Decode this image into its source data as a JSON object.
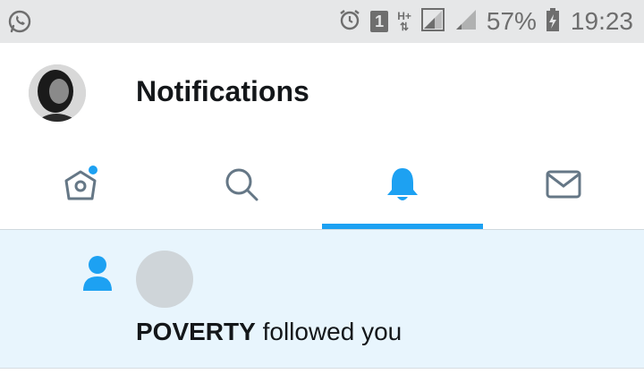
{
  "status_bar": {
    "left_icon": "whatsapp-icon",
    "icons": [
      "alarm-icon",
      "sim-1-badge",
      "hplus-network-icon",
      "signal-icon",
      "signal-weak-icon",
      "battery-charging-icon"
    ],
    "sim_badge": "1",
    "network_label": "H+",
    "battery_percent": "57%",
    "time": "19:23"
  },
  "header": {
    "title": "Notifications",
    "avatar": "profile-avatar"
  },
  "tabs": [
    {
      "name": "home",
      "icon": "home-icon",
      "has_dot": true
    },
    {
      "name": "search",
      "icon": "search-icon"
    },
    {
      "name": "notifications",
      "icon": "bell-icon",
      "active": true
    },
    {
      "name": "messages",
      "icon": "mail-icon"
    }
  ],
  "colors": {
    "accent": "#1da1f2",
    "icon_gray": "#657786",
    "highlight_bg": "#e8f5fd",
    "status_bar_bg": "#e6e7e8"
  },
  "notifications": [
    {
      "type": "follow",
      "icon": "person-icon",
      "name": "POVERTY",
      "text": "followed you"
    }
  ]
}
